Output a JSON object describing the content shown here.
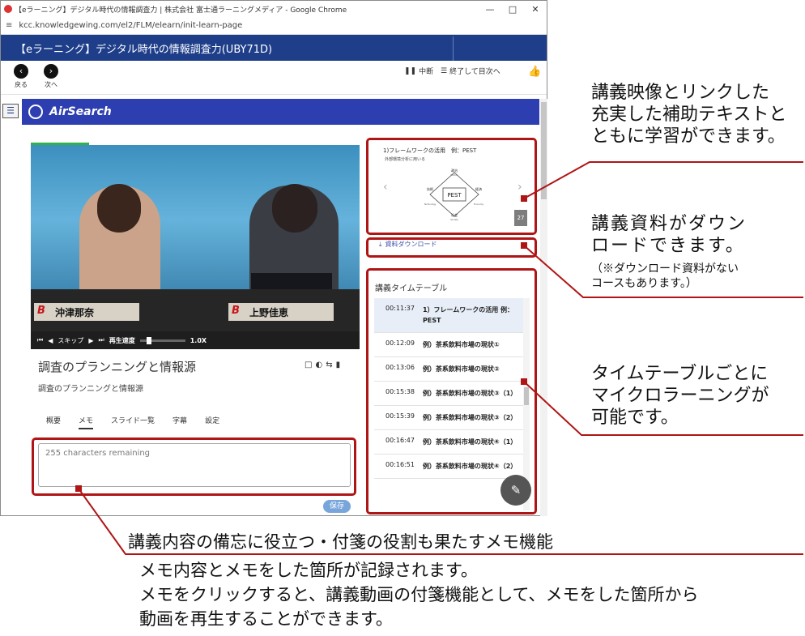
{
  "browser": {
    "title": "【eラーニング】デジタル時代の情報調査力 | 株式会社 富士通ラーニングメディア - Google Chrome",
    "url": "kcc.knowledgewing.com/el2/FLM/elearn/init-learn-page"
  },
  "app": {
    "course_title": "【eラーニング】デジタル時代の情報調査力(UBY71D)",
    "back_label": "戻る",
    "next_label": "次へ",
    "pause_label": "中断",
    "finish_label": "終了して目次へ",
    "brand": "AirSearch"
  },
  "video": {
    "nameplate_left": "沖津那奈",
    "nameplate_right": "上野佳恵",
    "skip_label": "スキップ",
    "speed_label": "再生速度",
    "speed_value": "1.0X",
    "speed_fraction": 0.15
  },
  "lecture": {
    "title": "調査のプランニングと情報源",
    "subtitle": "調査のプランニングと情報源",
    "tabs": [
      "概要",
      "メモ",
      "スライド一覧",
      "字幕",
      "設定"
    ],
    "active_tab": "メモ",
    "memo_placeholder": "255 characters remaining",
    "save_label": "保存"
  },
  "slide": {
    "title": "1)フレームワークの活用　例：PEST",
    "subtitle": "外部環境分析に用いる",
    "center": "PEST",
    "top": "政治",
    "top_en": "Politics",
    "left": "技術",
    "left_en": "Technology",
    "right": "経済",
    "right_en": "Economy",
    "bottom": "社会",
    "bottom_en": "Society",
    "page": "27",
    "download_label": "資料ダウンロード"
  },
  "timetable": {
    "heading": "講義タイムテーブル",
    "rows": [
      {
        "time": "00:11:37",
        "text": "1）フレームワークの活用 例：PEST"
      },
      {
        "time": "00:12:09",
        "text": "例）茶系飲料市場の現状①"
      },
      {
        "time": "00:13:06",
        "text": "例）茶系飲料市場の現状②"
      },
      {
        "time": "00:15:38",
        "text": "例）茶系飲料市場の現状③（1）"
      },
      {
        "time": "00:15:39",
        "text": "例）茶系飲料市場の現状③（2）"
      },
      {
        "time": "00:16:47",
        "text": "例）茶系飲料市場の現状④（1）"
      },
      {
        "time": "00:16:51",
        "text": "例）茶系飲料市場の現状④（2）"
      }
    ]
  },
  "annotations": {
    "a1": [
      "講義映像とリンクした",
      "充実した補助テキストと",
      "ともに学習ができます。"
    ],
    "a2": [
      "講義資料がダウン",
      "ロードできます。"
    ],
    "a2_note": [
      "（※ダウンロード資料がない",
      "コースもあります。）"
    ],
    "a3": [
      "タイムテーブルごとに",
      "マイクロラーニングが",
      "可能です。"
    ],
    "bottom_heading": "講義内容の備忘に役立つ・付箋の役割も果たすメモ機能",
    "bottom_lines": [
      "メモ内容とメモをした箇所が記録されます。",
      "メモをクリックすると、講義動画の付箋機能として、メモをした箇所から",
      "動画を再生することができます。"
    ]
  },
  "colors": {
    "accent": "#b01515",
    "header": "#1e3e8a",
    "brand_bar": "#2d3fb0"
  }
}
